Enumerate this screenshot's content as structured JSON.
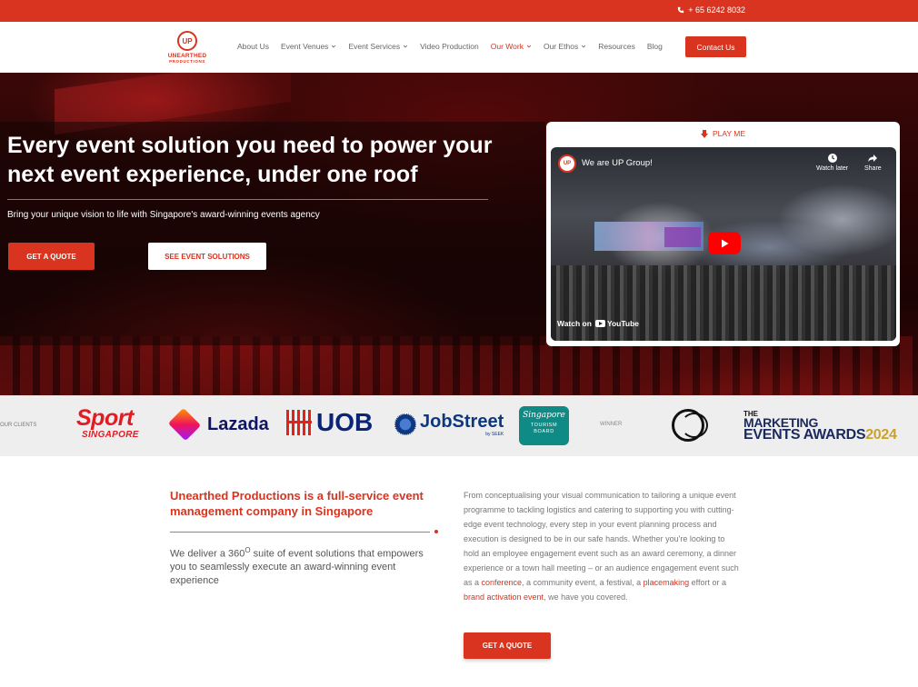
{
  "topbar": {
    "phone": "+ 65 6242 8032",
    "icon": "phone-icon"
  },
  "brand": {
    "mark": "UP",
    "name": "UNEARTHED",
    "tagline": "PRODUCTIONS"
  },
  "nav": {
    "items": [
      {
        "label": "About Us",
        "has_dropdown": false,
        "active": false
      },
      {
        "label": "Event Venues",
        "has_dropdown": true,
        "active": false
      },
      {
        "label": "Event Services",
        "has_dropdown": true,
        "active": false
      },
      {
        "label": "Video Production",
        "has_dropdown": false,
        "active": false
      },
      {
        "label": "Our Work",
        "has_dropdown": true,
        "active": true
      },
      {
        "label": "Our Ethos",
        "has_dropdown": true,
        "active": false
      },
      {
        "label": "Resources",
        "has_dropdown": false,
        "active": false
      },
      {
        "label": "Blog",
        "has_dropdown": false,
        "active": false
      }
    ],
    "contact_label": "Contact Us"
  },
  "hero": {
    "headline": "Every event solution you need to power your next event experience, under one roof",
    "subheadline": "Bring your unique vision to life with Singapore's award-winning events agency",
    "quote_label": "GET A QUOTE",
    "solutions_label": "SEE EVENT SOLUTIONS"
  },
  "video": {
    "play_label": "PLAY ME",
    "title": "We are UP Group!",
    "channel_mark": "UP",
    "watch_later": "Watch later",
    "share": "Share",
    "watch_on": "Watch on",
    "platform": "YouTube"
  },
  "clients": {
    "label": "OUR CLIENTS",
    "sport_line1": "Sport",
    "sport_line2": "SINGAPORE",
    "lazada": "Lazada",
    "uob": "UOB",
    "jobstreet": "JobStreet",
    "jobstreet_sub": "by SEEK",
    "stb_line1": "Singapore",
    "stb_line2": "TOURISM",
    "stb_line3": "BOARD",
    "winner_label": "WINNER",
    "award_line1": "THE",
    "award_line2": "MARKETING",
    "award_line3": "EVENTS AWARDS",
    "award_year": "2024"
  },
  "about": {
    "heading": "Unearthed Productions is a full-service event management company in Singapore",
    "intro_pre": "We deliver a 360",
    "intro_sup": "O",
    "intro_post": " suite of event solutions that empowers you to seamlessly execute an award-winning event experience",
    "body_part1": "From conceptualising your visual communication to tailoring a unique event programme to tackling logistics and catering to supporting you with cutting-edge event technology, every step in your event planning process and execution is designed to be in our safe hands. Whether you're looking to hold an employee engagement event such as an award ceremony, a dinner experience or a town hall meeting – or an audience engagement event such as a ",
    "link_conference": "conference",
    "body_part2": ", a community event, a festival, a ",
    "link_placemaking": "placemaking",
    "body_part3": " effort or a ",
    "link_activation": "brand activation event",
    "body_part4": ", we have you covered.",
    "quote_label": "GET A QUOTE"
  },
  "colors": {
    "accent": "#d8341f",
    "hero_dark": "#260404",
    "strip": "#eeeeee"
  }
}
